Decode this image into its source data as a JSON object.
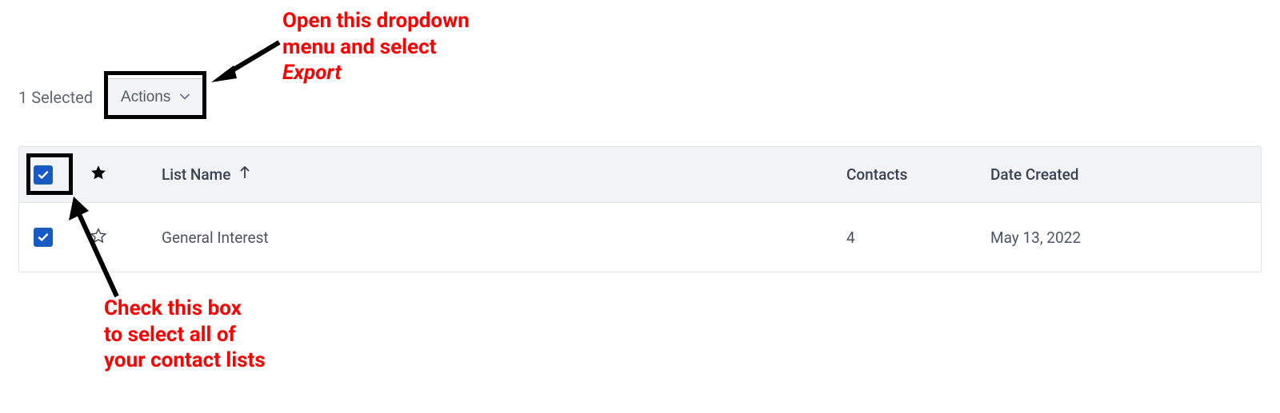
{
  "annotations": {
    "dropdown_instruction_line1": "Open this dropdown",
    "dropdown_instruction_line2": "menu and select",
    "dropdown_instruction_emph": "Export",
    "select_all_line1": "Check this box",
    "select_all_line2": "to select all of",
    "select_all_line3": "your contact lists"
  },
  "toolbar": {
    "selected_text": "1 Selected",
    "actions_label": "Actions"
  },
  "table": {
    "headers": {
      "list_name": "List Name",
      "contacts": "Contacts",
      "date_created": "Date Created"
    },
    "rows": [
      {
        "name": "General Interest",
        "contacts": "4",
        "date_created": "May 13, 2022"
      }
    ]
  }
}
